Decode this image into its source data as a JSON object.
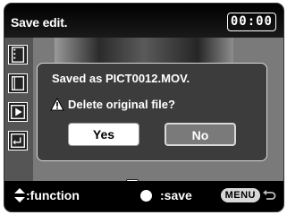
{
  "header": {
    "title": "Save edit.",
    "timer": "00:00"
  },
  "dialog": {
    "message": "Saved as PICT0012.MOV.",
    "question": "Delete original file?",
    "yes_label": "Yes",
    "no_label": "No"
  },
  "footer": {
    "function_label": ":function",
    "save_label": ":save",
    "menu_label": "MENU"
  },
  "icons": [
    "filmstrip-icon",
    "frame-icon",
    "play-icon",
    "enter-icon",
    "warning-icon",
    "trash-icon",
    "updown-arrows-icon",
    "return-icon"
  ],
  "colors": {
    "screen_background": "#7a7a7a",
    "bars": "#000000",
    "dialog_background": "#3c3c3c",
    "selected_button": "#ffffff"
  }
}
